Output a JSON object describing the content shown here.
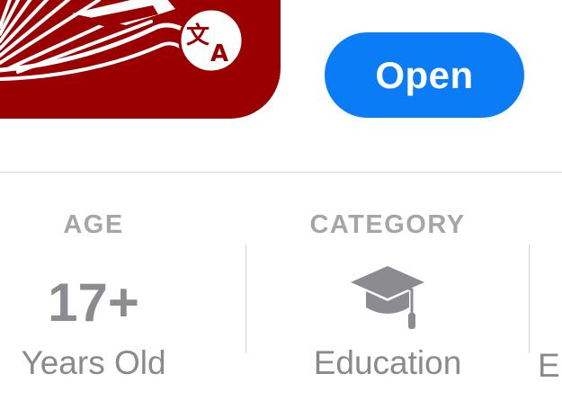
{
  "app": {
    "icon": "app-icon-translate-book",
    "icon_color": "#9b0000",
    "translate_badge_icon": "translate-icon"
  },
  "actions": {
    "open_label": "Open",
    "open_color": "#0a7cf6"
  },
  "info": {
    "age": {
      "header": "AGE",
      "value": "17+",
      "sub": "Years Old"
    },
    "category": {
      "header": "CATEGORY",
      "icon": "graduation-cap-icon",
      "sub": "Education"
    },
    "next": {
      "sub": "E"
    }
  }
}
